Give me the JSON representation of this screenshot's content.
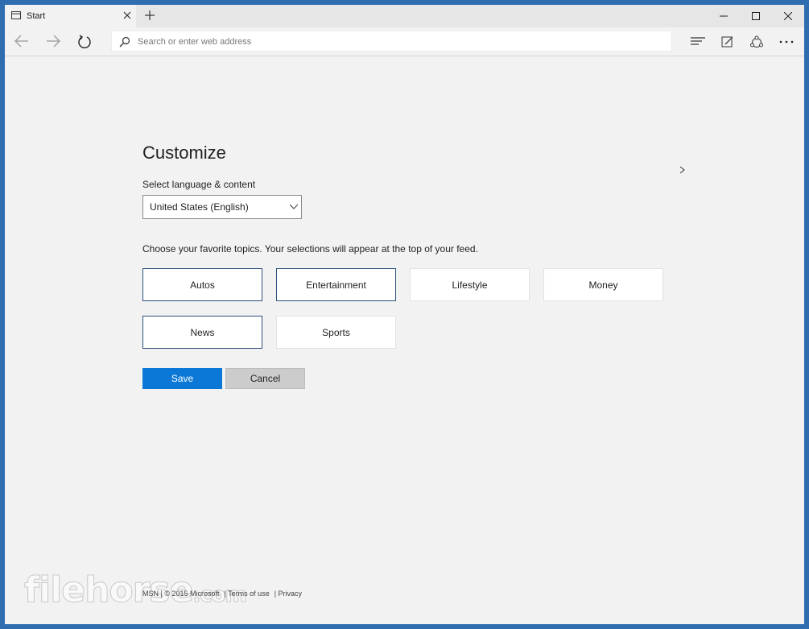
{
  "browser": {
    "tab_title": "Start",
    "address_placeholder": "Search or enter web address"
  },
  "icons": {
    "tab": "page-icon",
    "tab_close": "close-icon",
    "new_tab": "plus-icon",
    "back": "arrow-left-icon",
    "forward": "arrow-right-icon",
    "refresh": "refresh-icon",
    "search": "search-icon",
    "hub": "hub-icon",
    "note": "web-note-icon",
    "share": "share-icon",
    "more": "more-icon"
  },
  "page": {
    "title": "Customize",
    "language_label": "Select language & content",
    "language_value": "United States (English)",
    "topics_intro": "Choose your favorite topics. Your selections will appear at the top of your feed.",
    "topics": [
      {
        "label": "Autos",
        "selected": true
      },
      {
        "label": "Entertainment",
        "selected": true
      },
      {
        "label": "Lifestyle",
        "selected": false
      },
      {
        "label": "Money",
        "selected": false
      },
      {
        "label": "News",
        "selected": true
      },
      {
        "label": "Sports",
        "selected": false
      }
    ],
    "save_label": "Save",
    "cancel_label": "Cancel"
  },
  "footer": {
    "copyright": "MSN | © 2015 Microsoft",
    "terms": "| Terms of use",
    "privacy": "| Privacy"
  },
  "watermark": {
    "text": "filehorse",
    "suffix": ".com"
  },
  "colors": {
    "accent": "#0b78d7",
    "frame": "#2f6db0",
    "selected_border": "#2d4f7c"
  }
}
